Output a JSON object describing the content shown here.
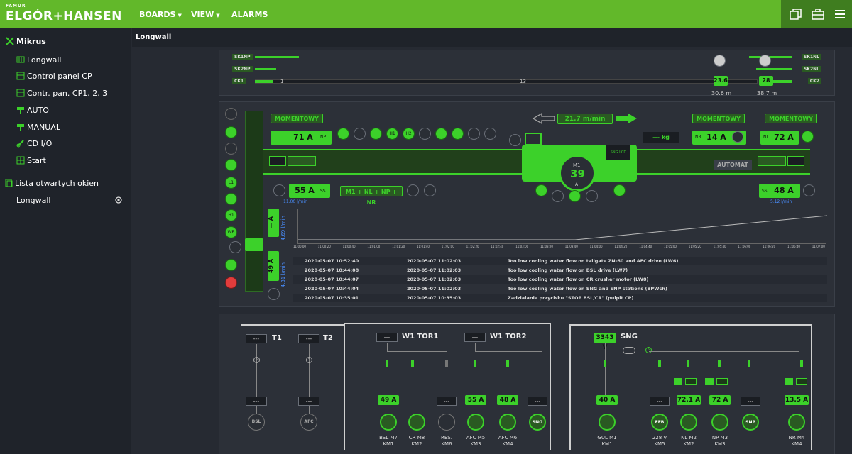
{
  "brand": {
    "small": "FAMUR",
    "name": "ELGÓR+HANSEN"
  },
  "nav": {
    "boards": "BOARDS",
    "view": "VIEW",
    "alarms": "ALARMS"
  },
  "sidebar": {
    "root": "Mikrus",
    "items": [
      "Longwall",
      "Control panel CP",
      "Contr. pan. CP1, 2, 3",
      "AUTO",
      "MANUAL",
      "CD I/O",
      "Start"
    ],
    "open_title": "Lista otwartych okien",
    "open_items": [
      "Longwall"
    ]
  },
  "breadcrumb": "Longwall",
  "top_panel": {
    "left_labels": [
      "SK1NP",
      "SK2NP",
      "CK1"
    ],
    "right_labels": [
      "SK1NL",
      "SK2NL",
      "CK2"
    ],
    "scale_start": "1",
    "scale_mid": "13",
    "pos_left": "23.6",
    "pos_left_dist": "30.6 m",
    "pos_right": "28",
    "pos_right_dist": "38.7 m"
  },
  "mid_panel": {
    "momentowy_left": "MOMENTOWY",
    "momentowy_r1": "MOMENTOWY",
    "momentowy_r2": "MOMENTOWY",
    "left_current": "71 A",
    "left_np": "NP",
    "left_lower_current": "55 A",
    "left_lower_tag": "SS",
    "left_flow": "11.00 l/min",
    "speed": "21.7 m/min",
    "kg": "--- kg",
    "right_nr": "NR",
    "right_current": "14 A",
    "right_nl": "NL",
    "right_current2": "72 A",
    "right_lower_current": "48 A",
    "right_lower_tag": "SS",
    "right_flow": "5.12 l/min",
    "mode": "M1 + NL + NP + NR",
    "shearer_m1": "M1",
    "shearer_value": "39",
    "shearer_unit": "A",
    "sng_lcd": "SNG LCD",
    "automat": "AUTOMAT",
    "icons_h1": "H1",
    "icons_h2": "H2",
    "icons_w": "W",
    "side_h1": "H1",
    "side_h2": "H2",
    "side_wb": "WB",
    "side_l": "L1",
    "vert1_val": "— A",
    "vert1_flow": "4.69 l/min",
    "vert2_tag": "M7",
    "vert2_val": "49 A",
    "vert2_flow": "4.31 l/min",
    "chart_ticks": [
      "11:00:00",
      "11:00:20",
      "11:00:40",
      "11:01:00",
      "11:01:20",
      "11:01:40",
      "11:02:00",
      "11:02:20",
      "11:02:40",
      "11:03:00",
      "11:03:20",
      "11:03:40",
      "11:04:00",
      "11:04:20",
      "11:04:40",
      "11:05:00",
      "11:05:20",
      "11:05:40",
      "11:06:00",
      "11:06:20",
      "11:06:40",
      "11:07:00"
    ],
    "events": [
      {
        "start": "2020-05-07 10:52:40",
        "end": "2020-05-07 11:02:03",
        "msg": "Too low cooling water flow on tailgate ZN-60 and AFC drive (LW6)"
      },
      {
        "start": "2020-05-07 10:44:08",
        "end": "2020-05-07 11:02:03",
        "msg": "Too low cooling water flow on BSL drive (LW7)"
      },
      {
        "start": "2020-05-07 10:44:07",
        "end": "2020-05-07 11:02:03",
        "msg": "Too low cooling water flow on CR crusher motor (LW8)"
      },
      {
        "start": "2020-05-07 10:44:04",
        "end": "2020-05-07 11:02:03",
        "msg": "Too low cooling water flow on SNG and SNP stations (BPWch)"
      },
      {
        "start": "2020-05-07 10:35:01",
        "end": "2020-05-07 10:35:03",
        "msg": "Zadziałanie przycisku \"STOP BSL/CR\" (pulpit CP)"
      }
    ]
  },
  "electrical": {
    "t1": "T1",
    "t2": "T2",
    "tor1": "W1 TOR1",
    "tor2": "W1 TOR2",
    "sng": "SNG",
    "sng_voltage": "3343 V",
    "dash": "---",
    "values": {
      "bsl": "49 A",
      "afc5": "55 A",
      "afc6": "48 A",
      "gul": "40 A",
      "nl": "72.1 A",
      "np": "72 A",
      "nr": "13.5 A"
    },
    "motors": [
      {
        "icon": "BSL",
        "name": "",
        "": ""
      },
      {
        "icon": "AFC",
        "name": ""
      }
    ],
    "motor_labels": {
      "bsl": [
        "BSL M7",
        "KM1"
      ],
      "cr": [
        "CR M8",
        "KM2"
      ],
      "res": [
        "RES.",
        "KM6"
      ],
      "afc5": [
        "AFC M5",
        "KM3"
      ],
      "afc6": [
        "AFC M6",
        "KM4"
      ],
      "gul": [
        "GUL M1",
        "KM1"
      ],
      "v228": [
        "228 V",
        "KM5"
      ],
      "nl": [
        "NL M2",
        "KM2"
      ],
      "np": [
        "NP M3",
        "KM3"
      ],
      "nr": [
        "NR M4",
        "KM4"
      ]
    },
    "motor_icons": {
      "bsl": "BSL",
      "afc": "AFC",
      "sng": "SNG",
      "eeb": "EEB",
      "snp": "SNP"
    }
  },
  "colors": {
    "green": "#3cd12a",
    "topbar": "#62b82a",
    "bg": "#262a32"
  }
}
